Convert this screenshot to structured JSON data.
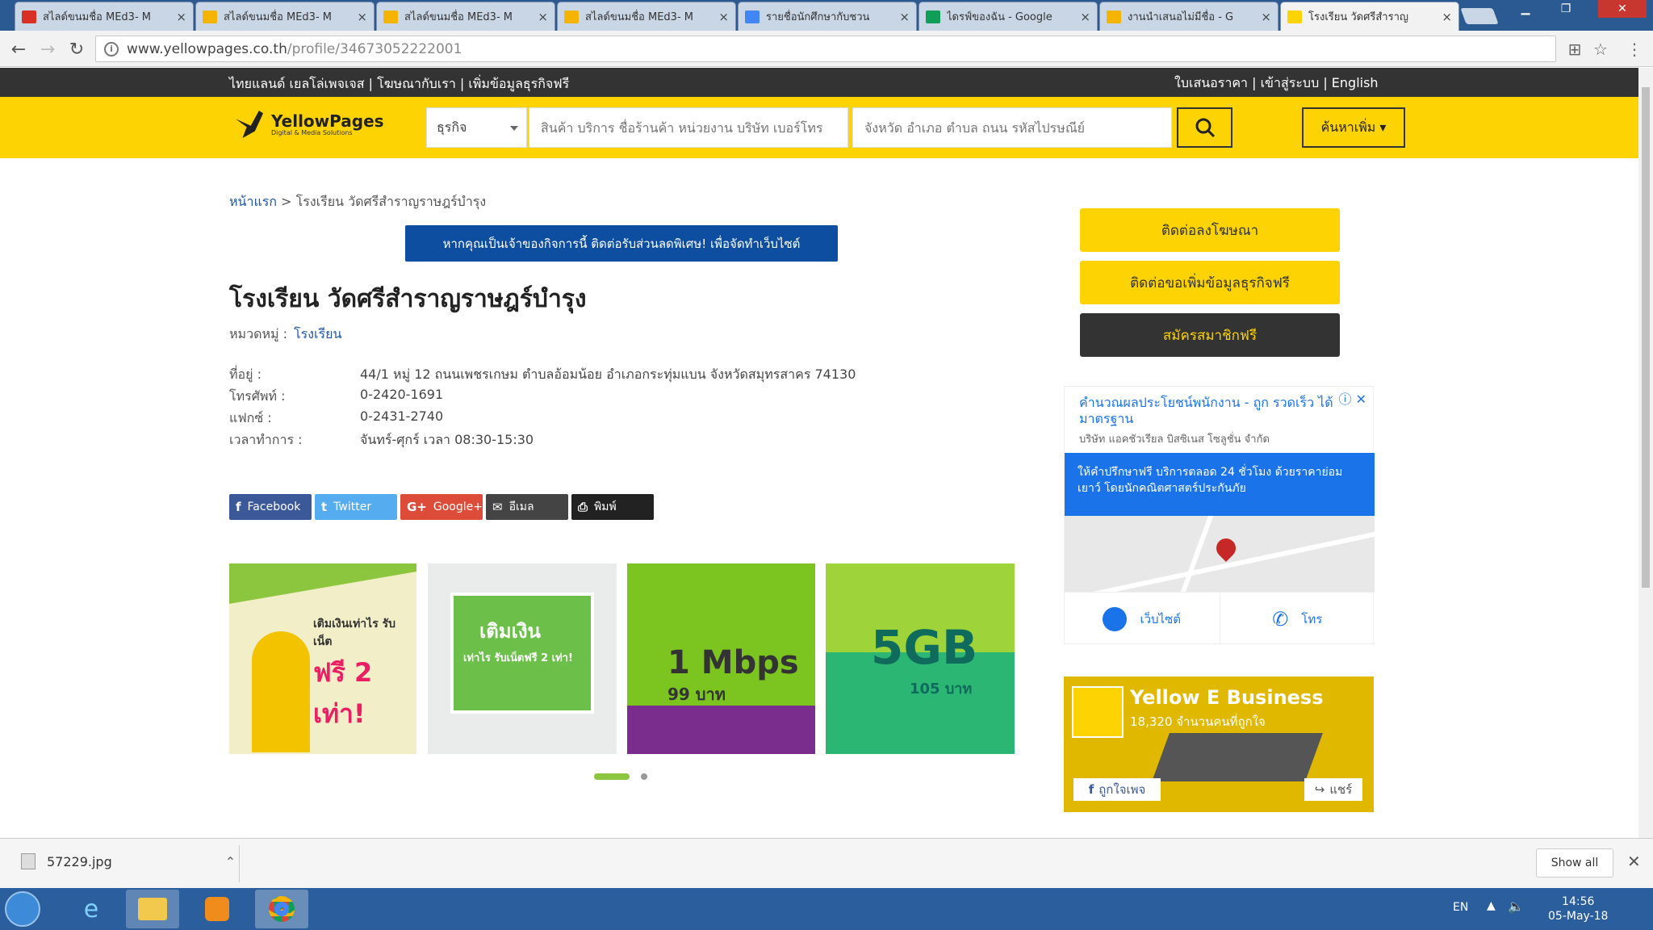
{
  "browser": {
    "tabs": [
      {
        "title": "สไลด์ขนมชื่อ MEd3- M",
        "color": "#d93025"
      },
      {
        "title": "สไลด์ขนมชื่อ MEd3- M",
        "color": "#f4b400"
      },
      {
        "title": "สไลด์ขนมชื่อ MEd3- M",
        "color": "#f4b400"
      },
      {
        "title": "สไลด์ขนมชื่อ MEd3- M",
        "color": "#f4b400"
      },
      {
        "title": "รายชื่อนักศึกษากับชวน",
        "color": "#4285f4"
      },
      {
        "title": "ไดรฟ์ของฉัน - Google",
        "color": "#0f9d58"
      },
      {
        "title": "งานนำเสนอไม่มีชื่อ - G",
        "color": "#f4b400"
      },
      {
        "title": "โรงเรียน วัดศรีสำราญ",
        "color": "#fdd303"
      }
    ],
    "url_domain": "www.yellowpages.co.th",
    "url_path": "/profile/34673052222001"
  },
  "topbar": {
    "left": "ไทยแลนด์ เยลโล่เพจเจส | โฆษณากับเรา | เพิ่มข้อมูลธุรกิจฟรี",
    "right": "ใบเสนอราคา | เข้าสู่ระบบ | English"
  },
  "header": {
    "logo_title": "YellowPages",
    "logo_sub": "Digital & Media Solutions",
    "category": "ธุรกิจ",
    "search_placeholder": "สินค้า บริการ ชื่อร้านค้า หน่วยงาน บริษัท เบอร์โทร",
    "location_placeholder": "จังหวัด อำเภอ ตำบล ถนน รหัสไปรษณีย์",
    "more_button": "ค้นหาเพิ่ม ▾"
  },
  "breadcrumb": {
    "home": "หน้าแรก",
    "separator": ">",
    "current": "โรงเรียน วัดศรีสำราญราษฎร์บำรุง"
  },
  "promo_banner": "หากคุณเป็นเจ้าของกิจการนี้ ติดต่อรับส่วนลดพิเศษ! เพื่อจัดทำเว็บไซต์",
  "business": {
    "name": "โรงเรียน วัดศรีสำราญราษฎร์บำรุง",
    "category_label": "หมวดหมู่ :",
    "category_value": "โรงเรียน",
    "details": [
      {
        "label": "ที่อยู่ :",
        "value": "44/1 หมู่ 12 ถนนเพชรเกษม ตำบลอ้อมน้อย อำเภอกระทุ่มแบน จังหวัดสมุทรสาคร 74130"
      },
      {
        "label": "โทรศัพท์ :",
        "value": "0-2420-1691"
      },
      {
        "label": "แฟกซ์ :",
        "value": "0-2431-2740"
      },
      {
        "label": "เวลาทำการ :",
        "value": "จันทร์-ศุกร์ เวลา 08:30-15:30"
      }
    ]
  },
  "share": [
    {
      "label": "Facebook",
      "icon": "f",
      "color": "#3b5998"
    },
    {
      "label": "Twitter",
      "icon": "t",
      "color": "#55acee"
    },
    {
      "label": "Google+",
      "icon": "G+",
      "color": "#dd4b39"
    },
    {
      "label": "อีเมล",
      "icon": "✉",
      "color": "#444444"
    },
    {
      "label": "พิมพ์",
      "icon": "⎙",
      "color": "#222222"
    }
  ],
  "ads": [
    {
      "line1": "เติมเงินเท่าไร รับเน็ต",
      "line2": "ฟรี 2 เท่า!",
      "bg": "#f2eec8"
    },
    {
      "line1": "เติมเงิน",
      "line2": "เท่าไร รับเน็ตฟรี 2 เท่า!",
      "bg": "#6cc04a"
    },
    {
      "line1": "1 Mbps",
      "line2": "99 บาท",
      "bg": "#7cc520"
    },
    {
      "line1": "5GB",
      "line2": "105 บาท",
      "bg": "#2bb673"
    }
  ],
  "sidebar": {
    "btn1": "ติดต่อลงโฆษณา",
    "btn2": "ติดต่อขอเพิ่มข้อมูลธุรกิจฟรี",
    "btn3": "สมัครสมาชิกฟรี",
    "ad_title": "คำนวณผลประโยชน์พนักงาน - ถูก รวดเร็ว ได้มาตรฐาน",
    "ad_sub": "บริษัท แอคชัวเรียล บิสซิเนส โซลูชั่น จำกัด",
    "ad_blue": "ให้คำปรึกษาฟรี บริการตลอด 24 ชั่วโมง ด้วยราคาย่อมเยาว์ โดยนักคณิตศาสตร์ประกันภัย",
    "ad_website": "เว็บไซต์",
    "ad_call": "โทร",
    "ebiz_title": "Yellow E Business",
    "ebiz_sub": "18,320 จำนวนคนที่ถูกใจ",
    "ebiz_like": "ถูกใจเพจ",
    "ebiz_share": "แชร์"
  },
  "download": {
    "file": "57229.jpg",
    "show_all": "Show all"
  },
  "taskbar": {
    "lang": "EN",
    "time": "14:56",
    "date": "05-May-18"
  }
}
